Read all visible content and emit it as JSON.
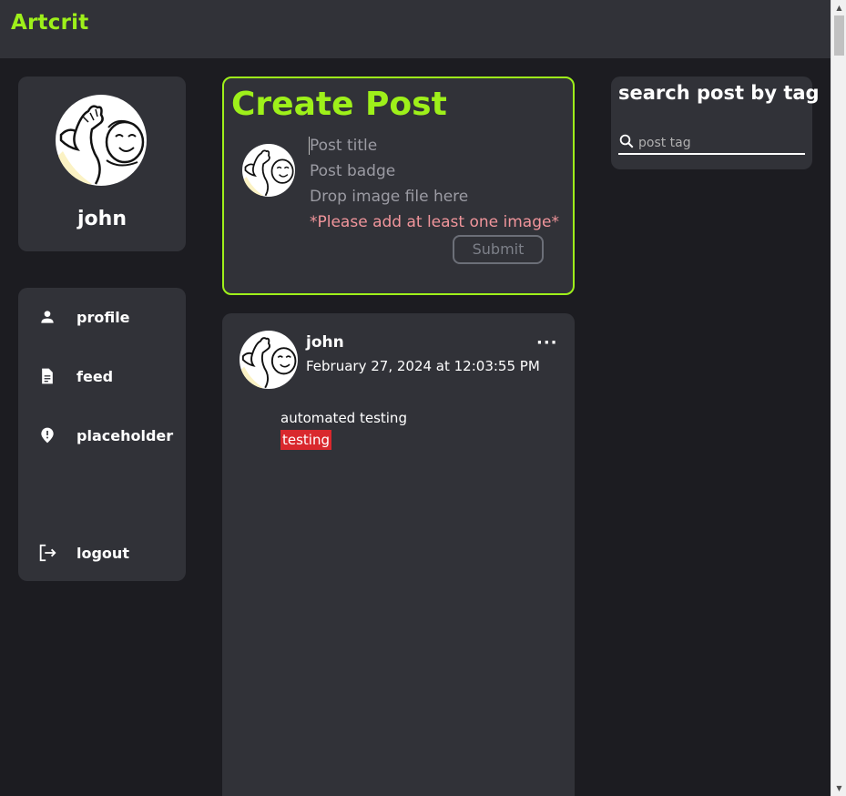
{
  "app": {
    "brand": "Artcrit"
  },
  "profile": {
    "name": "john"
  },
  "nav": {
    "items": [
      {
        "label": "profile",
        "icon": "person-icon"
      },
      {
        "label": "feed",
        "icon": "document-icon"
      },
      {
        "label": "placeholder",
        "icon": "alert-location-icon"
      },
      {
        "label": "logout",
        "icon": "logout-icon"
      }
    ]
  },
  "create_post": {
    "title": "Create Post",
    "title_placeholder": "Post title",
    "badge_placeholder": "Post badge",
    "drop_text": "Drop image file here",
    "error_text": "*Please add at least one image*",
    "submit_label": "Submit"
  },
  "post": {
    "author": "john",
    "date": "February 27, 2024 at 12:03:55 PM",
    "menu": "···",
    "text": "automated testing",
    "tag": "testing"
  },
  "search": {
    "title": "search post by tag",
    "placeholder": "post tag"
  },
  "colors": {
    "accent": "#9ef01a",
    "background": "#1c1c21",
    "card": "#313238",
    "error": "#f0959b",
    "tag": "#d9282d"
  }
}
